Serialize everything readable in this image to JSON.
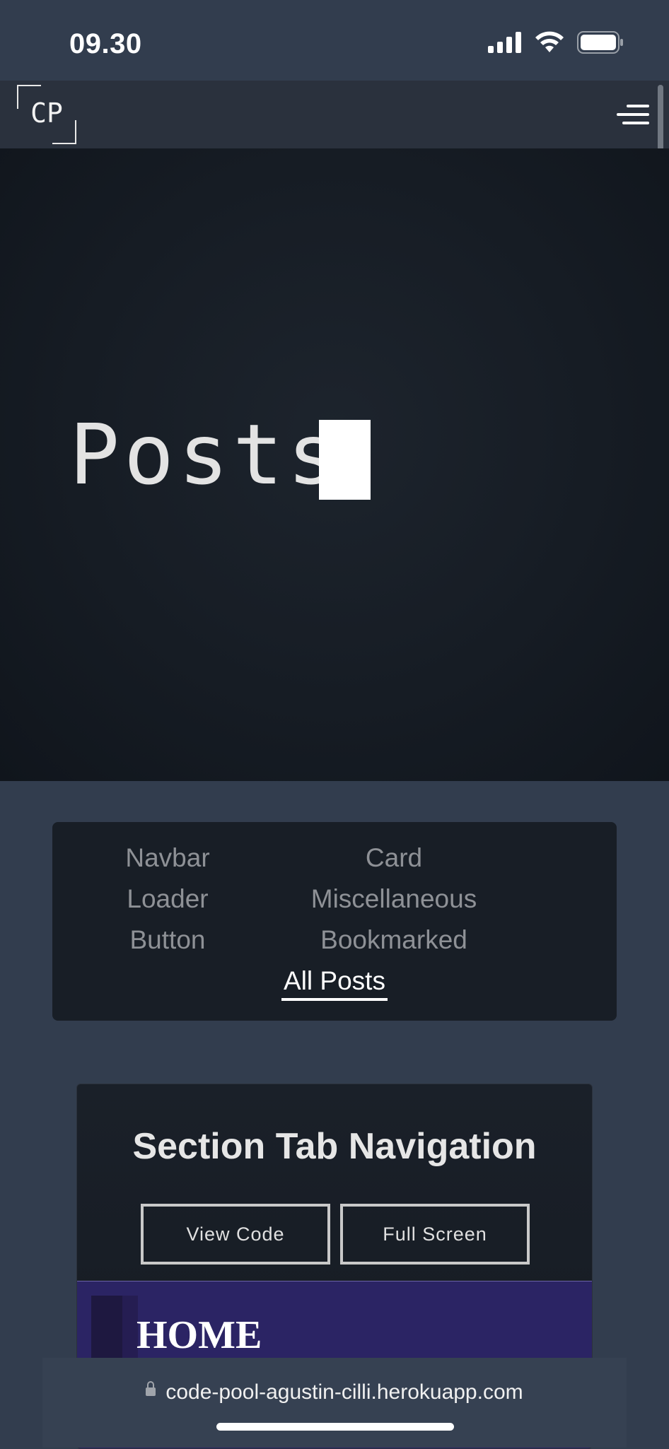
{
  "status": {
    "time": "09.30"
  },
  "nav": {
    "logo": "CP"
  },
  "hero": {
    "title": "Posts"
  },
  "filters": {
    "items": [
      "Navbar",
      "Card",
      "Loader",
      "Miscellaneous",
      "Button",
      "Bookmarked"
    ],
    "active": "All Posts"
  },
  "card": {
    "title": "Section Tab Navigation",
    "view_code_label": "View Code",
    "full_screen_label": "Full Screen",
    "preview_text": "HOME"
  },
  "browser": {
    "url": "code-pool-agustin-cilli.herokuapp.com"
  },
  "colors": {
    "background": "#323d4e",
    "hero": "#161c24",
    "panel": "#181e26",
    "preview": "#2b2464"
  }
}
